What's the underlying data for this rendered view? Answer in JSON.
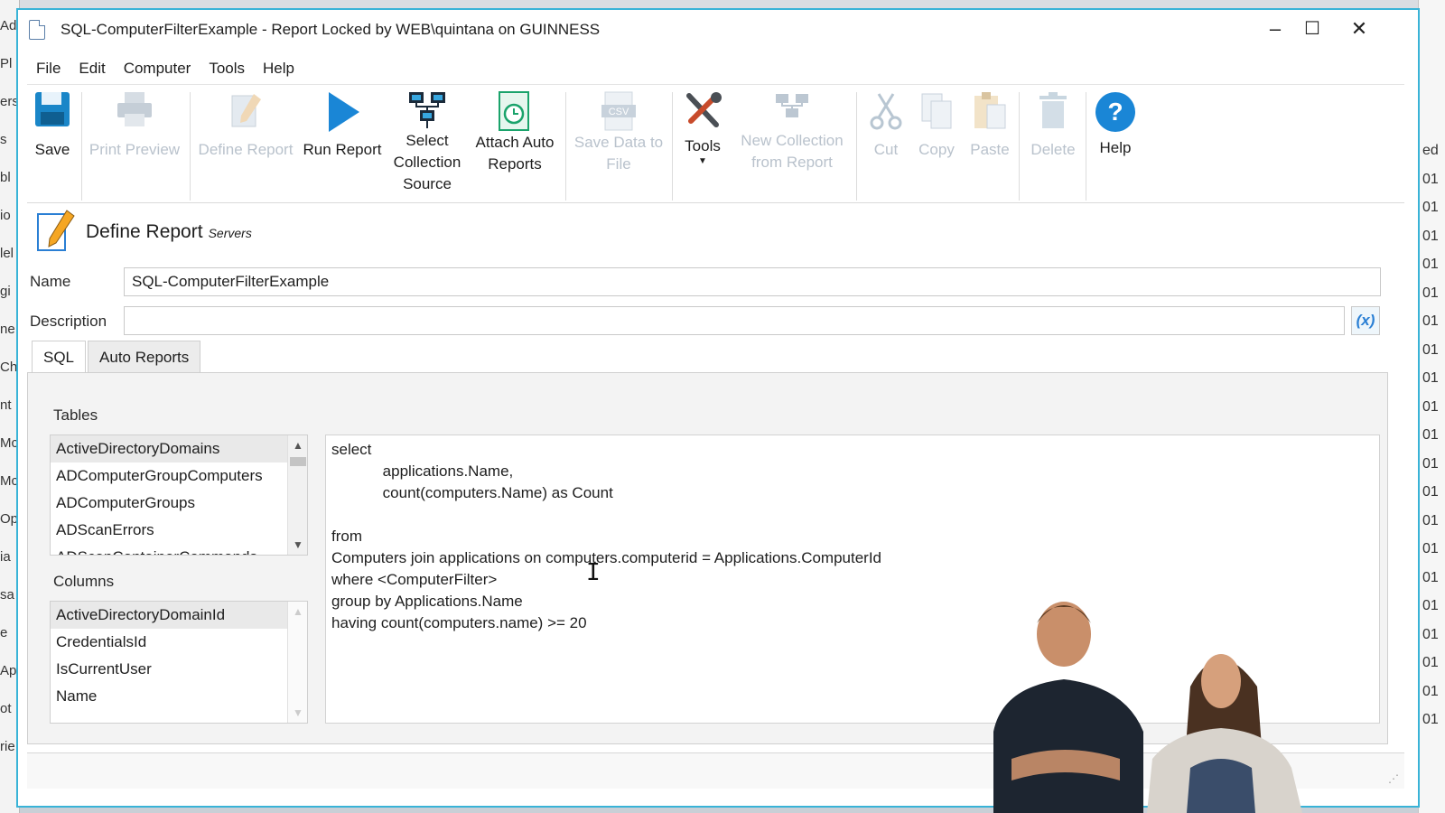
{
  "window": {
    "title": "SQL-ComputerFilterExample - Report Locked by WEB\\quintana on GUINNESS",
    "controls": {
      "minimize": "–",
      "maximize": "☐",
      "close": "✕"
    }
  },
  "menu": [
    "File",
    "Edit",
    "Computer",
    "Tools",
    "Help"
  ],
  "toolbar": {
    "save": "Save",
    "print_preview": "Print Preview",
    "define_report": "Define Report",
    "run_report": "Run Report",
    "select_collection_source": [
      "Select",
      "Collection",
      "Source"
    ],
    "attach_auto_reports": [
      "Attach Auto",
      "Reports"
    ],
    "save_data_to_file": [
      "Save Data to",
      "File"
    ],
    "tools": "Tools",
    "new_collection_from_report": [
      "New Collection",
      "from Report"
    ],
    "cut": "Cut",
    "copy": "Copy",
    "paste": "Paste",
    "delete": "Delete",
    "help": "Help"
  },
  "header": {
    "title": "Define Report",
    "subtitle": "Servers"
  },
  "form": {
    "name_label": "Name",
    "name_value": "SQL-ComputerFilterExample",
    "description_label": "Description",
    "description_value": "",
    "fx_button": "(x)"
  },
  "tabs": [
    "SQL",
    "Auto Reports"
  ],
  "tables": {
    "label": "Tables",
    "items": [
      "ActiveDirectoryDomains",
      "ADComputerGroupComputers",
      "ADComputerGroups",
      "ADScanErrors",
      "ADScanContainerCommands"
    ]
  },
  "columns": {
    "label": "Columns",
    "items": [
      "ActiveDirectoryDomainId",
      "CredentialsId",
      "IsCurrentUser",
      "Name"
    ]
  },
  "sql_lines": [
    "select",
    "            applications.Name,",
    "            count(computers.Name) as Count",
    "",
    "from",
    "Computers join applications on computers.computerid = Applications.ComputerId",
    "where <ComputerFilter>",
    "group by Applications.Name",
    "having count(computers.name) >= 20"
  ],
  "background": {
    "left_fragments": [
      "Ad",
      "Pl",
      "ers",
      "s",
      "bl",
      "io",
      "lel",
      "gi",
      "ne",
      "Ch",
      "nt",
      "Mc",
      "Mc",
      "Op",
      "ia",
      "sa",
      "e",
      "Ap",
      "ot",
      "rie"
    ],
    "right_fragments": [
      "ed",
      "01",
      "01",
      "01",
      "01",
      "01",
      "01",
      "01",
      "01",
      "01",
      "01",
      "01",
      "01",
      "01",
      "01",
      "01",
      "01",
      "01",
      "01",
      "01",
      "01"
    ]
  }
}
